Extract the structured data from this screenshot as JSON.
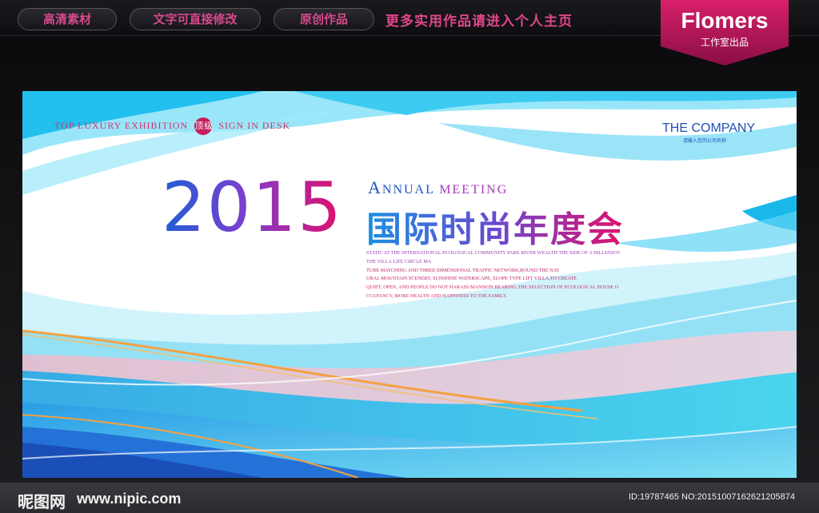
{
  "topbar": {
    "pills": [
      "高清素材",
      "文字可直接修改",
      "原创作品"
    ],
    "promo": "更多实用作品请进入个人主页",
    "badge_title": "Flomers",
    "badge_subtitle": "工作室出品"
  },
  "banner": {
    "tagline_parts": [
      "Top luxury exhibition",
      "顶级",
      "Sign in desk"
    ],
    "company_name": "THE COMPANY",
    "company_sub": "请输入您的公司名称",
    "year": "2015",
    "annual_a": "A",
    "annual_rest": "NNUAL",
    "meeting": "MEETING",
    "title_cn": "国际时尚年度会",
    "paragraph": [
      "STATIC AT THE INTERNATIONAL ECOLOGICAL COMMUNITY PARK RIVER WEALTH THE SIDE OF A HILLENJOY",
      "THE VILLA LIFE CIRCLE MA",
      "TURE MATCHING AND THREE-DIMENSIONAL TRAFFIC NETWORK,ROUND THE NAT",
      "URAL MOUNTAIN SCENERY, SUNSHINE WATERSCAPE, SLOPE TYPE LIFT VILLA,TO CREATE",
      "QUIET, OPEN, AND PEOPLE DO NOT HARASS MANSION BEARING,THE SELECTION OF ECOLOGICAL HOUSE O",
      "CCUPANCY, MORE HEALTH AND HAPPINESS TO THE FAMILY."
    ]
  },
  "footer": {
    "logo": "昵图网",
    "url": "www.nipic.com",
    "image_id": "ID:19787465 NO:20151007162621205874"
  },
  "colors": {
    "accent_pink": "#e0106a",
    "accent_blue": "#1e5fd4",
    "wave_cyan": "#22c8ee"
  }
}
